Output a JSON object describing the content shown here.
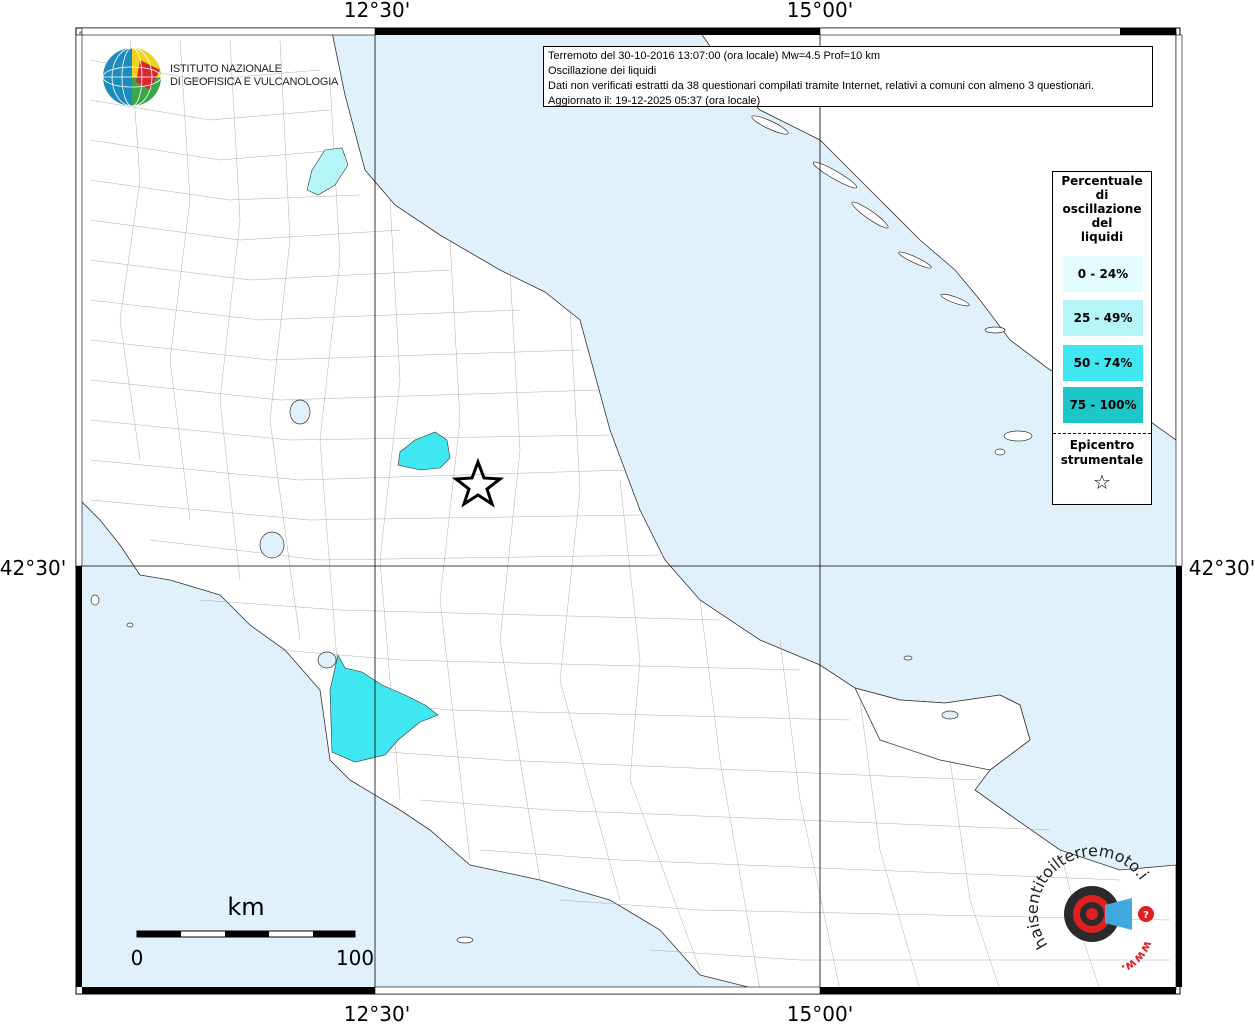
{
  "map": {
    "coordinates": {
      "lon_top_left": "12°30'",
      "lon_top_right": "15°00'",
      "lon_bottom_left": "12°30'",
      "lon_bottom_right": "15°00'",
      "lat_left": "42°30'",
      "lat_right": "42°30'"
    },
    "colors": {
      "sea": "#e0f1fb",
      "land": "#ffffff",
      "class_0_24": "#e3fdfd",
      "class_25_49": "#b5f5f8",
      "class_50_74": "#3fe7f0",
      "class_75_100": "#1dc7c9"
    }
  },
  "info": {
    "line1": "Terremoto del 30-10-2016 13:07:00 (ora locale) Mw=4.5 Prof=10 km",
    "line2": "Oscillazione dei liquidi",
    "line3": "Dati non verificati estratti da 38 questionari compilati tramite Internet, relativi a comuni con almeno 3 questionari.",
    "line4": "Aggiornato il: 19-12-2025 05:37 (ora locale)"
  },
  "logo": {
    "line1": "ISTITUTO NAZIONALE",
    "line2": "DI GEOFISICA E VULCANOLOGIA"
  },
  "legend": {
    "title_line1": "Percentuale",
    "title_line2": "di",
    "title_line3": "oscillazione",
    "title_line4": "del",
    "title_line5": "liquidi",
    "items": [
      {
        "label": "0 - 24%"
      },
      {
        "label": "25 - 49%"
      },
      {
        "label": "50 - 74%"
      },
      {
        "label": "75 - 100%"
      }
    ],
    "epicenter_line1": "Epicentro",
    "epicenter_line2": "strumentale",
    "epicenter_symbol": "☆"
  },
  "scale": {
    "unit": "km",
    "min": "0",
    "max": "100"
  },
  "watermark": {
    "text": "haisentitoilterremoto.it",
    "url_text": "www."
  }
}
